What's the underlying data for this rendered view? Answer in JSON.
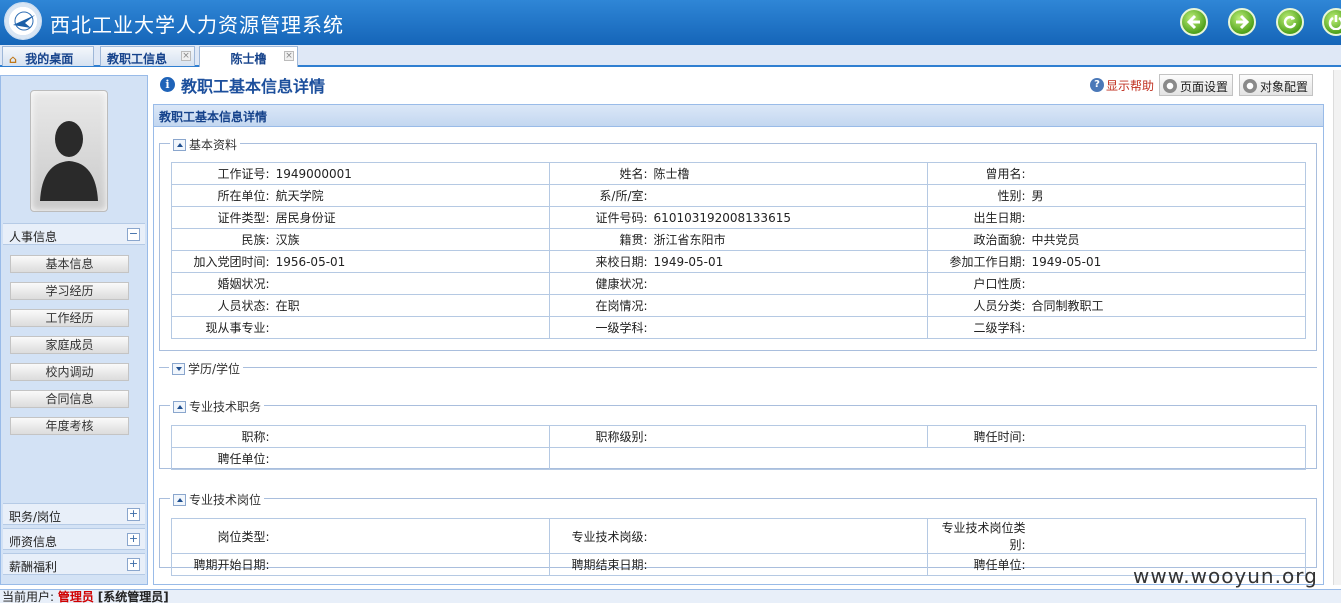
{
  "header": {
    "title": "西北工业大学人力资源管理系统",
    "buttons": [
      "back-icon",
      "forward-icon",
      "refresh-icon",
      "power-icon"
    ]
  },
  "tabs": [
    {
      "label": "我的桌面",
      "icon": "home-icon"
    },
    {
      "label": "教职工信息",
      "closable": true
    },
    {
      "label": "陈士橹",
      "closable": true,
      "active": true
    }
  ],
  "sidebar": {
    "section1": {
      "label": "人事信息",
      "toggle": "−"
    },
    "items": [
      "基本信息",
      "学习经历",
      "工作经历",
      "家庭成员",
      "校内调动",
      "合同信息",
      "年度考核"
    ],
    "sections": [
      {
        "label": "职务/岗位",
        "toggle": "+"
      },
      {
        "label": "师资信息",
        "toggle": "+"
      },
      {
        "label": "薪酬福利",
        "toggle": "+"
      }
    ]
  },
  "page": {
    "title": "教职工基本信息详情",
    "help": "显示帮助",
    "page_settings": "页面设置",
    "object_config": "对象配置",
    "panel_title": "教职工基本信息详情"
  },
  "basic": {
    "legend": "基本资料",
    "rows": [
      [
        [
          "工作证号:",
          "1949000001"
        ],
        [
          "姓名:",
          "陈士橹"
        ],
        [
          "曾用名:",
          ""
        ]
      ],
      [
        [
          "所在单位:",
          "航天学院"
        ],
        [
          "系/所/室:",
          ""
        ],
        [
          "性别:",
          "男"
        ]
      ],
      [
        [
          "证件类型:",
          "居民身份证"
        ],
        [
          "证件号码:",
          "610103192008133615"
        ],
        [
          "出生日期:",
          ""
        ]
      ],
      [
        [
          "民族:",
          "汉族"
        ],
        [
          "籍贯:",
          "浙江省东阳市"
        ],
        [
          "政治面貌:",
          "中共党员"
        ]
      ],
      [
        [
          "加入党团时间:",
          "1956-05-01"
        ],
        [
          "来校日期:",
          "1949-05-01"
        ],
        [
          "参加工作日期:",
          "1949-05-01"
        ]
      ],
      [
        [
          "婚姻状况:",
          ""
        ],
        [
          "健康状况:",
          ""
        ],
        [
          "户口性质:",
          ""
        ]
      ],
      [
        [
          "人员状态:",
          "在职"
        ],
        [
          "在岗情况:",
          ""
        ],
        [
          "人员分类:",
          "合同制教职工"
        ]
      ],
      [
        [
          "现从事专业:",
          ""
        ],
        [
          "一级学科:",
          ""
        ],
        [
          "二级学科:",
          ""
        ]
      ]
    ]
  },
  "education": {
    "legend": "学历/学位"
  },
  "tech_title": {
    "legend": "专业技术职务",
    "rows": [
      [
        [
          "职称:",
          ""
        ],
        [
          "职称级别:",
          ""
        ],
        [
          "聘任时间:",
          ""
        ]
      ],
      [
        [
          "聘任单位:",
          ""
        ]
      ]
    ]
  },
  "tech_post": {
    "legend": "专业技术岗位",
    "rows": [
      [
        [
          "岗位类型:",
          ""
        ],
        [
          "专业技术岗级:",
          ""
        ],
        [
          "专业技术岗位类别:",
          ""
        ]
      ],
      [
        [
          "聘期开始日期:",
          ""
        ],
        [
          "聘期结束日期:",
          ""
        ],
        [
          "聘任单位:",
          ""
        ]
      ]
    ]
  },
  "watermark": "www.wooyun.org",
  "status": {
    "prefix": "当前用户:",
    "user": "管理员",
    "role": "[系统管理员]"
  }
}
